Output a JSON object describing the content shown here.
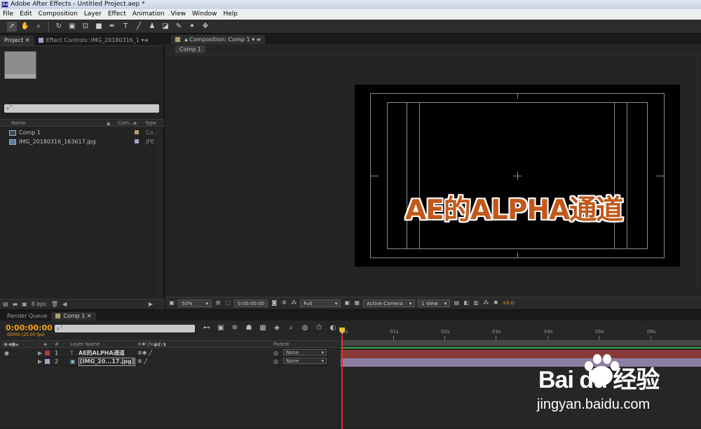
{
  "window": {
    "title": "Adobe After Effects - Untitled Project.aep *",
    "logo": "Ae"
  },
  "menu": [
    "File",
    "Edit",
    "Composition",
    "Layer",
    "Effect",
    "Animation",
    "View",
    "Window",
    "Help"
  ],
  "project_panel": {
    "tab_project": "Project",
    "tab_effects": "Effect Controls: IMG_20180316_1",
    "search_glyph": "⌕˅",
    "col_name": "Name",
    "col_comment": "Com...",
    "col_type": "Type",
    "items": [
      {
        "name": "Comp 1",
        "type": "Co",
        "color": "#b0a070"
      },
      {
        "name": "IMG_20180316_163617.jpg",
        "type": "JPE",
        "color": "#a9a2c9"
      }
    ],
    "bpc": "8 bpc"
  },
  "comp_panel": {
    "tab": "Composition: Comp 1",
    "subtab": "Comp 1",
    "overlay_text": "AE的ALPHA通道",
    "zoom": "50%",
    "timecode": "0:00:00:00",
    "resolution": "Full",
    "camera": "Active Camera",
    "views": "1 View",
    "exposure": "+0.0"
  },
  "timeline": {
    "tab_render": "Render Queue",
    "tab_comp": "Comp 1",
    "timecode": "0:00:00:00",
    "fps_text": "00000 (25.00 fps)",
    "search_glyph": "⌕˅",
    "col_hash": "#",
    "col_layer": "Layer Name",
    "col_parent": "Parent",
    "layers": [
      {
        "num": "1",
        "name": "AE的ALPHA通道",
        "parent": "None",
        "color": "#b33a3a",
        "type_icon": "T"
      },
      {
        "num": "2",
        "name": "[IMG_20...17.jpg]",
        "parent": "None",
        "color": "#a9a2c9",
        "type_icon": "▣"
      }
    ],
    "ruler": [
      "0s",
      "01s",
      "02s",
      "03s",
      "04s",
      "05s",
      "06s"
    ]
  },
  "watermark": {
    "logo": "Bai  du 经验",
    "site": "jingyan.baidu.com"
  }
}
